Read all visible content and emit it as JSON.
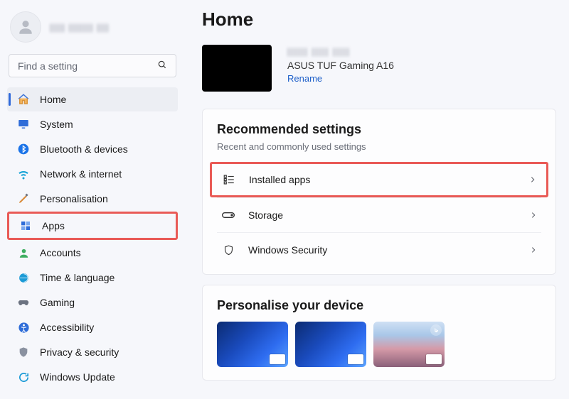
{
  "profile": {
    "name_obscured": "||||| |||||||| ||||"
  },
  "search": {
    "placeholder": "Find a setting"
  },
  "nav": {
    "home": "Home",
    "system": "System",
    "bluetooth": "Bluetooth & devices",
    "network": "Network & internet",
    "personalisation": "Personalisation",
    "apps": "Apps",
    "accounts": "Accounts",
    "time": "Time & language",
    "gaming": "Gaming",
    "accessibility": "Accessibility",
    "privacy": "Privacy & security",
    "update": "Windows Update"
  },
  "page": {
    "title": "Home"
  },
  "device": {
    "owner_obscured": "|||||| ||||| |||||",
    "model": "ASUS TUF Gaming A16",
    "rename": "Rename"
  },
  "recommended": {
    "title": "Recommended settings",
    "subtitle": "Recent and commonly used settings",
    "items": {
      "installed_apps": "Installed apps",
      "storage": "Storage",
      "security": "Windows Security"
    }
  },
  "personalise": {
    "title": "Personalise your device"
  }
}
